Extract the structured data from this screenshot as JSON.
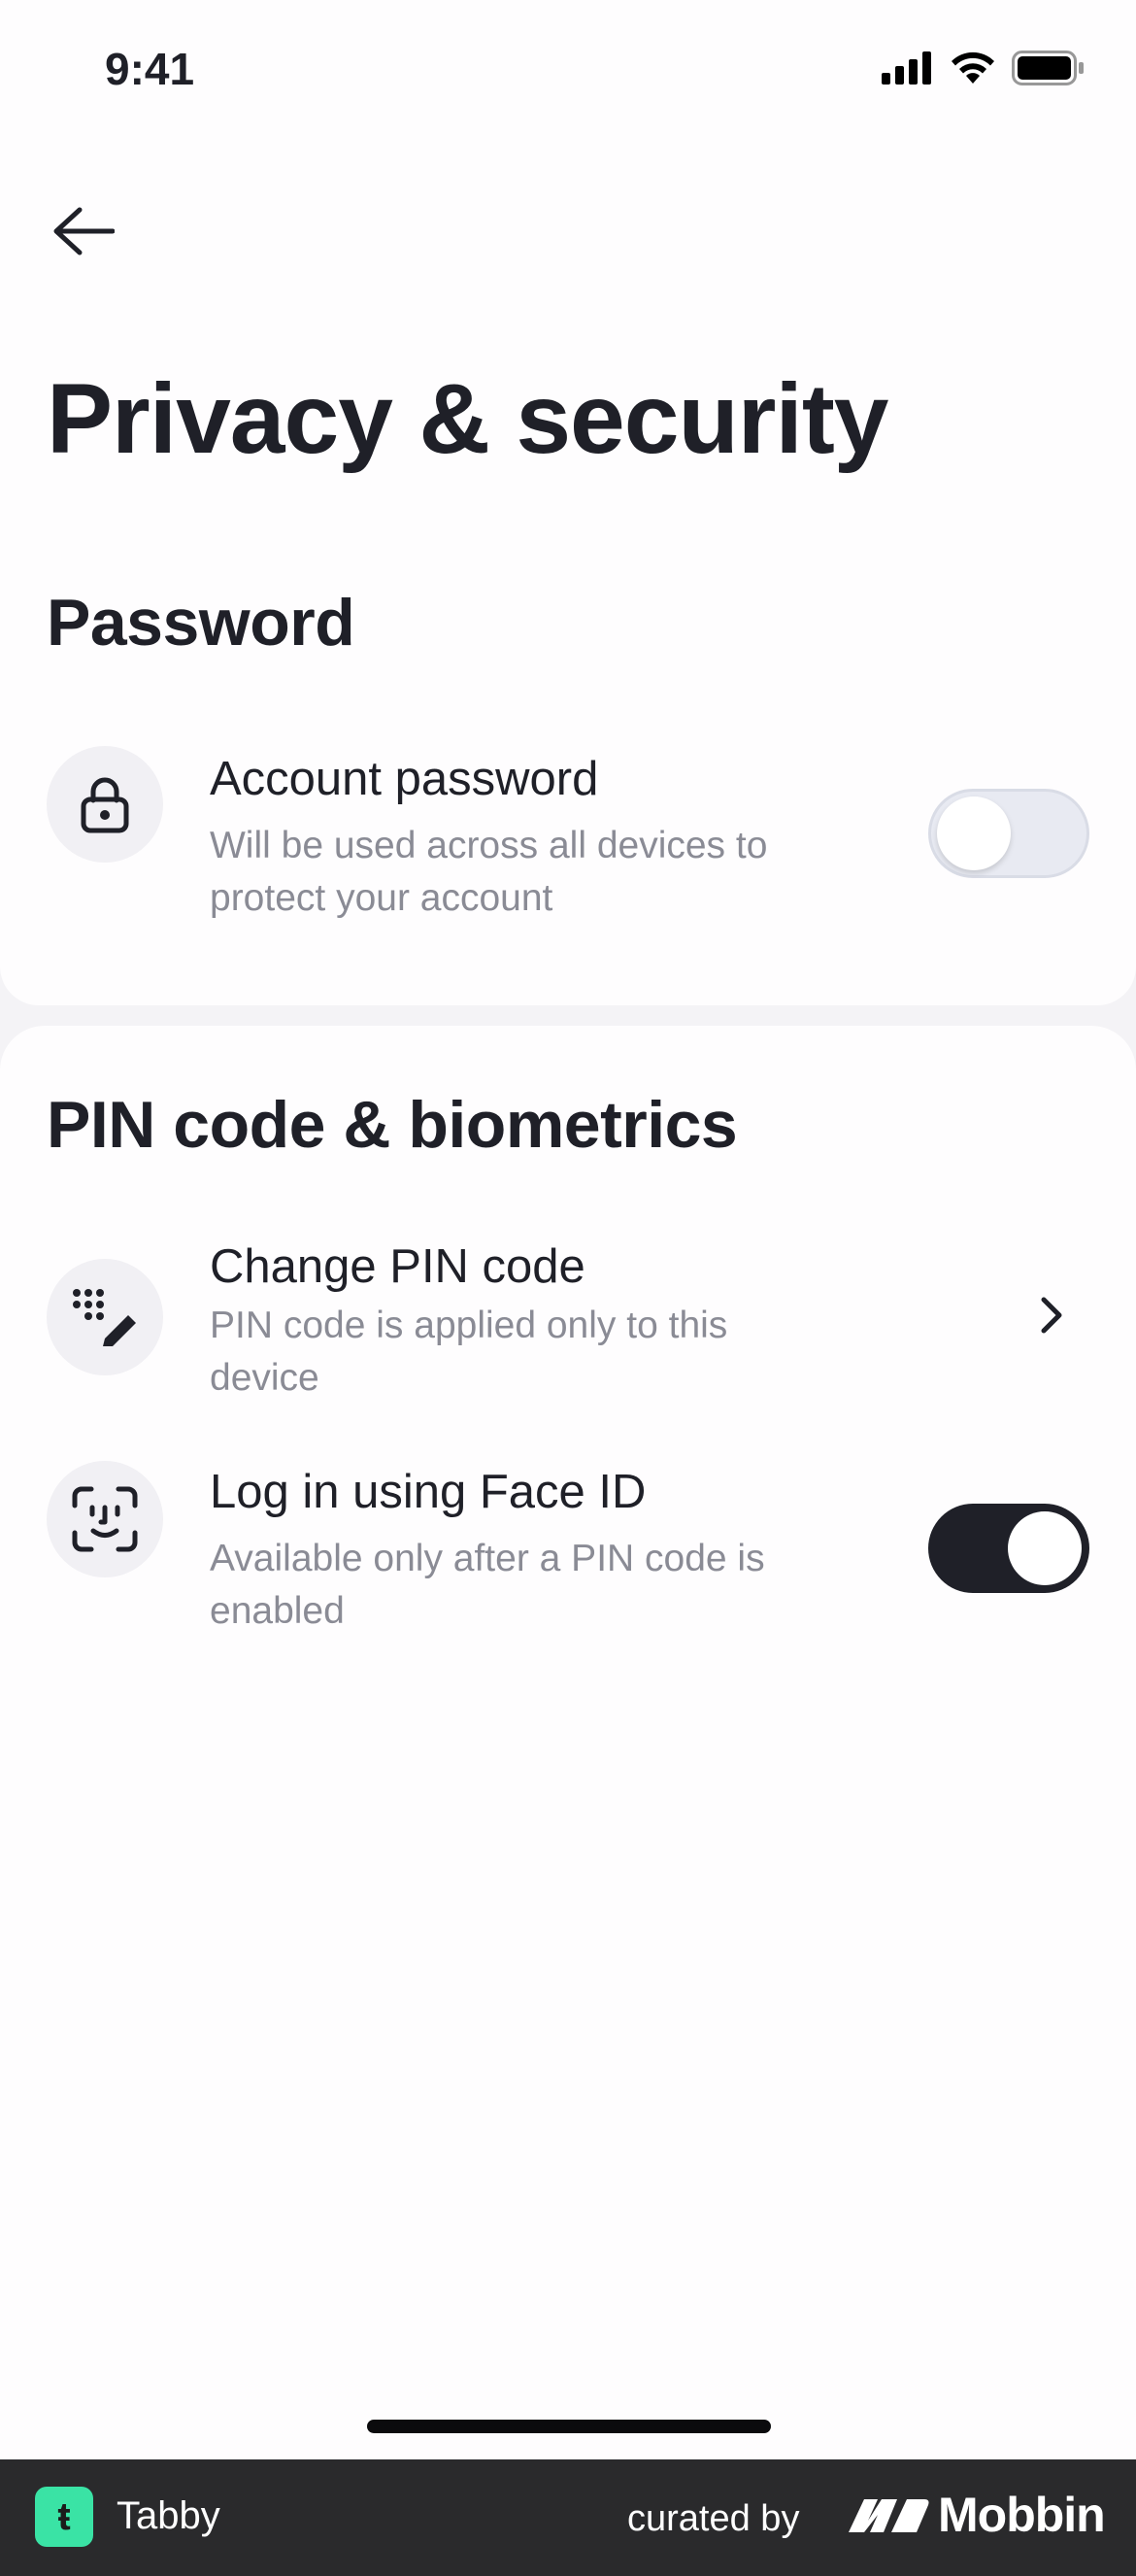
{
  "status_bar": {
    "time": "9:41"
  },
  "header": {
    "title": "Privacy & security"
  },
  "sections": [
    {
      "title": "Password",
      "items": [
        {
          "title": "Account password",
          "subtitle": "Will be used across all devices to protect your account",
          "icon": "lock-icon",
          "control": "toggle",
          "enabled": false
        }
      ]
    },
    {
      "title": "PIN code & biometrics",
      "items": [
        {
          "title": "Change PIN code",
          "subtitle": "PIN code is applied only to this device",
          "icon": "pin-edit-icon",
          "control": "chevron"
        },
        {
          "title": "Log in using Face ID",
          "subtitle": "Available only after a PIN code is enabled",
          "icon": "face-id-icon",
          "control": "toggle",
          "enabled": true
        }
      ]
    }
  ],
  "footer": {
    "app_name": "Tabby",
    "app_logo_glyph": "ŧ",
    "curated_by": "curated by",
    "curator": "Mobbin"
  },
  "colors": {
    "background": "#fefdfe",
    "divider": "#f4f3f6",
    "text_primary": "#1f2028",
    "text_secondary": "#8a8b95",
    "toggle_on": "#1f2028",
    "toggle_off": "#e8eaf2",
    "brand_accent": "#3ae3a5",
    "footer_bg": "#2a2a2c"
  }
}
